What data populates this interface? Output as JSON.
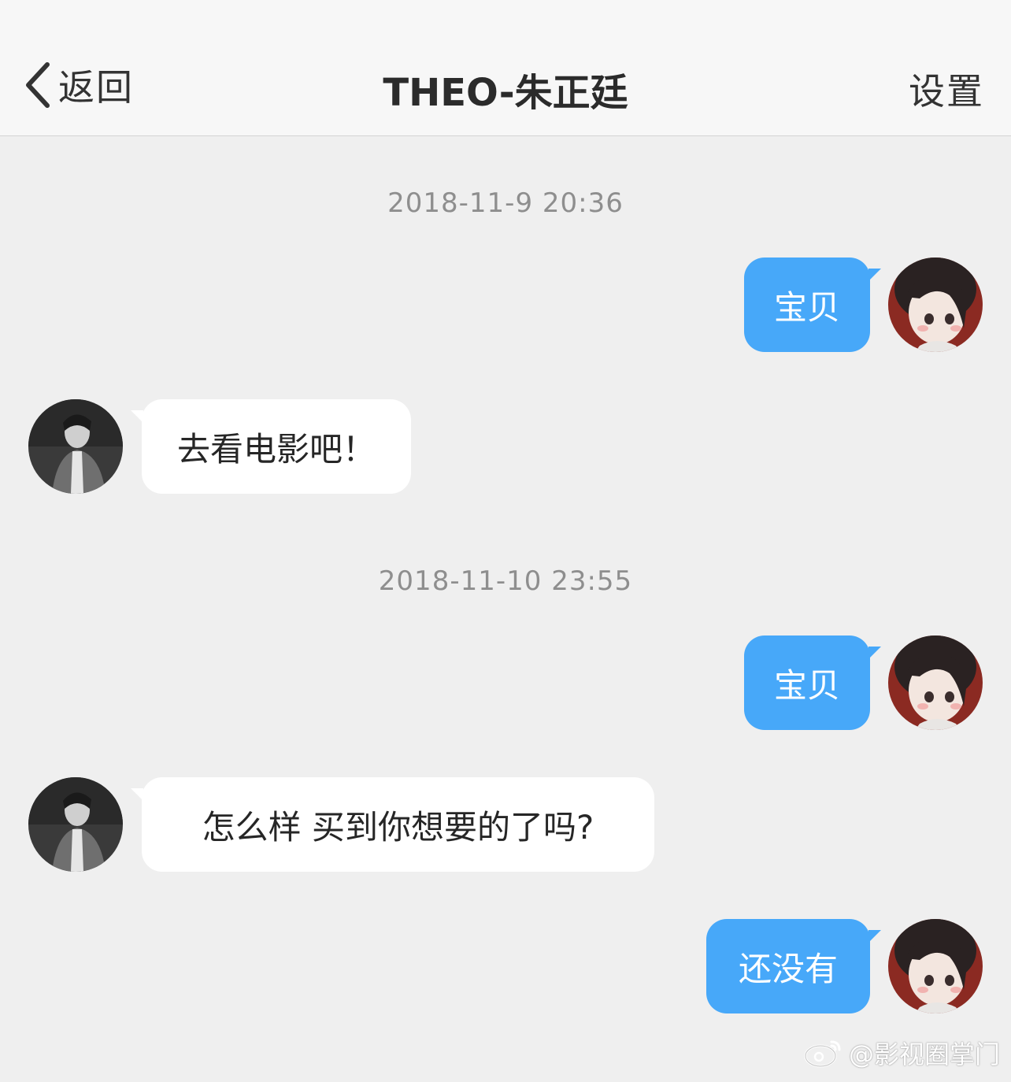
{
  "header": {
    "back_label": "返回",
    "title": "THEO-朱正廷",
    "settings_label": "设置"
  },
  "chat": {
    "timestamps": [
      "2018-11-9 20:36",
      "2018-11-10 23:55"
    ],
    "messages": [
      {
        "side": "outgoing",
        "text": "宝贝"
      },
      {
        "side": "incoming",
        "text": "去看电影吧！"
      },
      {
        "side": "outgoing",
        "text": "宝贝"
      },
      {
        "side": "incoming",
        "text": "怎么样 买到你想要的了吗?"
      },
      {
        "side": "outgoing",
        "text": "还没有"
      }
    ]
  },
  "watermark": {
    "text": "@影视圈掌门",
    "icon": "weibo-icon"
  },
  "colors": {
    "outgoing_bubble": "#47a8f9",
    "incoming_bubble": "#ffffff",
    "background": "#efefef",
    "header_background": "#f7f7f7"
  }
}
